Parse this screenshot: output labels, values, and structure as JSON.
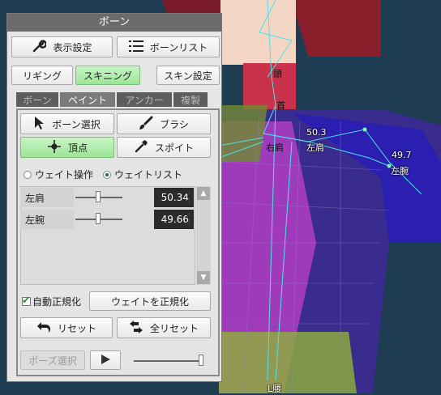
{
  "panel": {
    "title": "ボーン"
  },
  "toolbar": {
    "display_settings": "表示設定",
    "bone_list": "ボーンリスト"
  },
  "modes": {
    "rigging": "リギング",
    "skinning": "スキニング",
    "skin_settings": "スキン設定"
  },
  "tabs": [
    "ボーン",
    "ペイント",
    "アンカー",
    "複製"
  ],
  "tools": {
    "bone_select": "ボーン選択",
    "brush": "ブラシ",
    "vertex": "頂点",
    "eyedropper": "スポイト"
  },
  "radios": {
    "weight_op": "ウェイト操作",
    "weight_list": "ウェイトリスト"
  },
  "weights": [
    {
      "name": "左肩",
      "value": "50.34",
      "level": 0.5
    },
    {
      "name": "左腕",
      "value": "49.66",
      "level": 0.5
    }
  ],
  "options": {
    "auto_normalize": "自動正規化",
    "normalize_button": "ウェイトを正規化"
  },
  "reset": {
    "reset": "リセット",
    "reset_all": "全リセット"
  },
  "pose": {
    "pose_select": "ポーズ選択"
  },
  "viewport": {
    "bone_labels": [
      "頭",
      "首",
      "右肩",
      "左肩",
      "左腕",
      "L腰"
    ],
    "weight_values": [
      "50.3",
      "49.7"
    ]
  },
  "colors": {
    "accent_green": "#9de49a",
    "title_bar": "#6b6b6b",
    "viewport_bg": "#1e3d52"
  }
}
